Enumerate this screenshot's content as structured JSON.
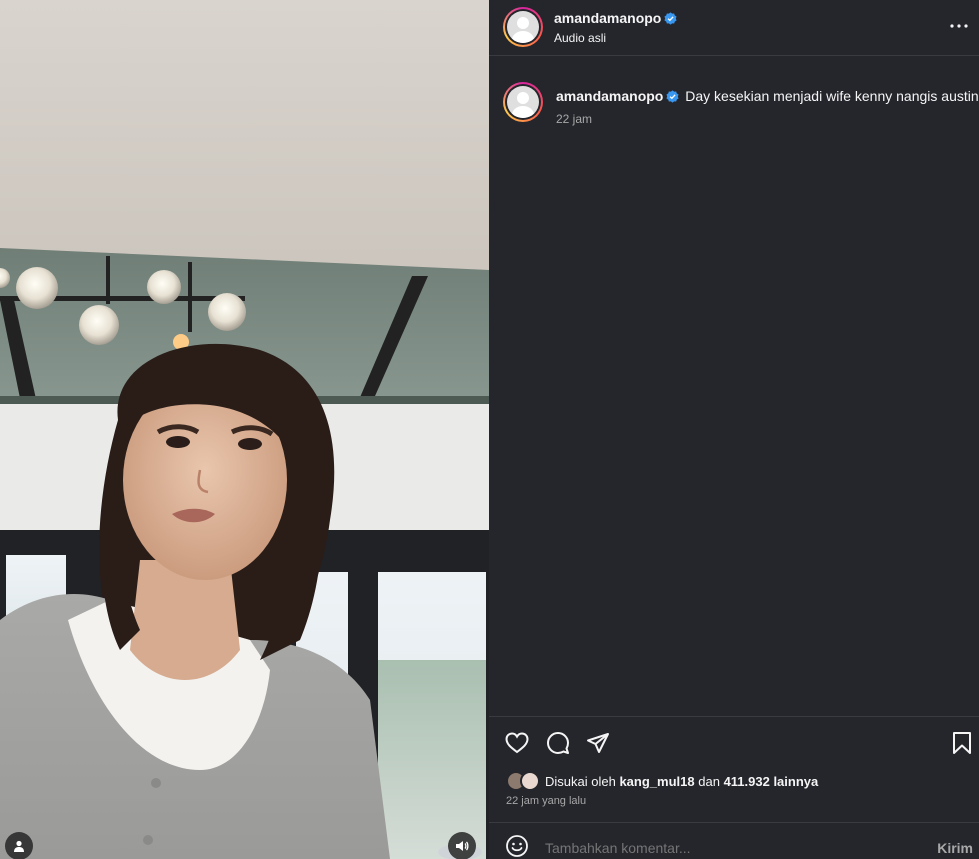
{
  "post": {
    "username": "amandamanopo",
    "verified": true,
    "audio_label": "Audio asli",
    "caption": "Day kesekian menjadi wife kenny nangis austin",
    "caption_time": "22 jam"
  },
  "engagement": {
    "liked_by_prefix": "Disukai oleh",
    "liked_by_user": "kang_mul18",
    "liked_by_connector": "dan",
    "liked_by_others": "411.932 lainnya",
    "posted_ago": "22 jam yang lalu"
  },
  "comment": {
    "placeholder": "Tambahkan komentar...",
    "send_label": "Kirim"
  },
  "icons": {
    "header_menu": "more-horizontal-icon",
    "like": "heart-icon",
    "comment": "comment-bubble-icon",
    "share": "paper-plane-icon",
    "save": "bookmark-icon",
    "emoji": "smiley-icon",
    "user_tag": "person-icon",
    "audio": "speaker-icon",
    "verified": "verified-badge-icon"
  },
  "colors": {
    "panel_bg": "#25262c",
    "verified_blue": "#3897f0",
    "muted_text": "#a8a8a8"
  }
}
